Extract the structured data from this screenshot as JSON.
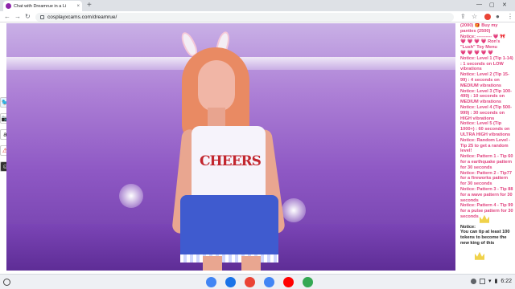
{
  "browser": {
    "tab_title": "Chat with Dreamrue in a Li",
    "tab_close": "×",
    "new_tab": "+",
    "url": "cosplayxcams.com/dreamrue/",
    "back": "←",
    "forward": "→",
    "reload": "↻"
  },
  "window_controls": {
    "minimize": "—",
    "maximize": "▢",
    "close": "✕"
  },
  "stream": {
    "shirt_text": "CHEERS"
  },
  "chat": {
    "lines": [
      {
        "text": "(2000) 🎁 Buy my panties (2500)",
        "style": "pink"
      },
      {
        "text": "Notice: ---------- 💗 🎀",
        "style": "pink"
      },
      {
        "text": "💗 💗 💗 💗 Ron's",
        "style": "hearts"
      },
      {
        "text": "\"Lush\" Toy Menu",
        "style": "pink"
      },
      {
        "text": "💗 💗 💗 💗 💗",
        "style": "hearts"
      },
      {
        "text": "Notice: Level 1 (Tip 1-14) : 1 seconds on LOW vibrations",
        "style": "pink"
      },
      {
        "text": "Notice: Level 2 (Tip 15-99) : 4 seconds on MEDIUM vibrations",
        "style": "pink"
      },
      {
        "text": "Notice: Level 3 (Tip 100-499) : 10 seconds on MEDIUM vibrations",
        "style": "pink"
      },
      {
        "text": "Notice: Level 4 (Tip 500-999) : 30 seconds on HIGH vibrations",
        "style": "pink"
      },
      {
        "text": "Notice: Level 5 (Tip 1000+) : 60 seconds on ULTRA HIGH vibrations",
        "style": "pink"
      },
      {
        "text": "Notice: Random Level - Tip 25 to get a random level!",
        "style": "pink"
      },
      {
        "text": "Notice: Pattern 1 - Tip 60 for a earthquake pattern for 30 seconds",
        "style": "pink"
      },
      {
        "text": "Notice: Pattern 2 - Tip77 for a fireworks pattern for 30 seconds",
        "style": "pink"
      },
      {
        "text": "Notice: Pattern 3 - Tip 88 for a wave pattern for 30 seconds",
        "style": "pink"
      },
      {
        "text": "Notice: Pattern 4 - Tip 99 for a pulse pattern for 30 seconds",
        "style": "pink"
      }
    ],
    "king_notice_label": "Notice:",
    "king_notice_text": "You can tip at least 100 tokens to become the new king of this"
  },
  "taskbar": {
    "apps": [
      {
        "name": "chrome",
        "color": "#4285f4"
      },
      {
        "name": "files",
        "color": "#1a73e8"
      },
      {
        "name": "gmail",
        "color": "#ea4335"
      },
      {
        "name": "docs",
        "color": "#4285f4"
      },
      {
        "name": "youtube",
        "color": "#ff0000"
      },
      {
        "name": "play-store",
        "color": "#34a853"
      }
    ],
    "clock": "6:22"
  }
}
